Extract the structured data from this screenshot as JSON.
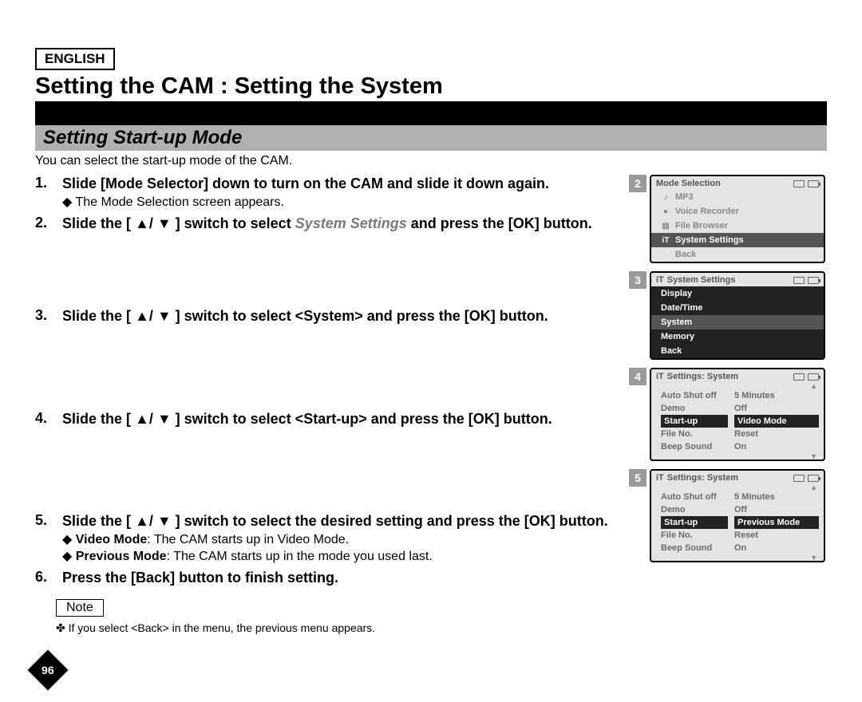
{
  "lang": "ENGLISH",
  "main_title": "Setting the CAM : Setting the System",
  "sub_title": "Setting Start-up Mode",
  "intro": "You can select the start-up mode of the CAM.",
  "steps": [
    {
      "num": "1.",
      "main_pre": "Slide [Mode Selector] down to turn on the CAM and slide it down again.",
      "sub": "The Mode Selection screen appears."
    },
    {
      "num": "2.",
      "main_pre": "Slide the [ ▲/ ▼ ] switch to select ",
      "main_italic": "System Settings",
      "main_post": " and press the [OK] button."
    },
    {
      "num": "3.",
      "main_pre": "Slide the [ ▲/ ▼ ] switch to select <System> and press the [OK] button."
    },
    {
      "num": "4.",
      "main_pre": "Slide the [ ▲/ ▼ ] switch to select <Start-up> and press the [OK] button."
    },
    {
      "num": "5.",
      "main_pre": "Slide the [ ▲/ ▼ ] switch to select the desired setting and press the [OK] button.",
      "subs": [
        {
          "b": "Video Mode",
          "t": ": The CAM starts up in Video Mode."
        },
        {
          "b": "Previous Mode",
          "t": ": The CAM starts up in the mode you used last."
        }
      ]
    },
    {
      "num": "6.",
      "main_pre": "Press the [Back] button to finish setting."
    }
  ],
  "note_label": "Note",
  "note_item": "If you select <Back> in the menu, the previous menu appears.",
  "page_num": "96",
  "panels": {
    "p2": {
      "num": "2",
      "title": "Mode Selection",
      "items": [
        {
          "icon": "♪",
          "label": "MP3"
        },
        {
          "icon": "●",
          "label": "Voice Recorder"
        },
        {
          "icon": "▤",
          "label": "File Browser"
        },
        {
          "icon": "iT",
          "label": "System Settings",
          "sel": true
        },
        {
          "icon": "",
          "label": "Back"
        }
      ]
    },
    "p3": {
      "num": "3",
      "title": "System Settings",
      "title_icon": "iT",
      "items": [
        {
          "label": "Display",
          "black": true
        },
        {
          "label": "Date/Time",
          "black": true
        },
        {
          "label": "System",
          "sel": true
        },
        {
          "label": "Memory",
          "black": true
        },
        {
          "label": "Back",
          "black": true
        }
      ]
    },
    "p4": {
      "num": "4",
      "title": "Settings: System",
      "title_icon": "iT",
      "rows": [
        {
          "c1": "Auto Shut off",
          "c2": "5 Minutes"
        },
        {
          "c1": "Demo",
          "c2": "Off"
        },
        {
          "c1": "Start-up",
          "c2": "Video Mode",
          "sel": true
        },
        {
          "c1": "File No.",
          "c2": "Reset"
        },
        {
          "c1": "Beep Sound",
          "c2": "On"
        }
      ]
    },
    "p5": {
      "num": "5",
      "title": "Settings: System",
      "title_icon": "iT",
      "rows": [
        {
          "c1": "Auto Shut off",
          "c2": "5 Minutes"
        },
        {
          "c1": "Demo",
          "c2": "Off"
        },
        {
          "c1": "Start-up",
          "c2": "Previous Mode",
          "sel": true
        },
        {
          "c1": "File No.",
          "c2": "Reset"
        },
        {
          "c1": "Beep Sound",
          "c2": "On"
        }
      ]
    }
  }
}
